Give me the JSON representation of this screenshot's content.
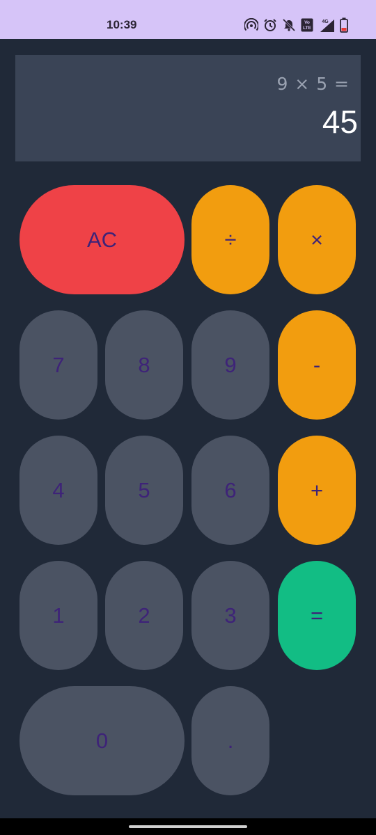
{
  "status_bar": {
    "time": "10:39",
    "icons": [
      "hotspot-icon",
      "alarm-icon",
      "mute-icon",
      "volte-icon",
      "signal-4g-icon",
      "battery-low-icon"
    ],
    "volte_text": "Vo LTE",
    "network_label": "4G"
  },
  "display": {
    "expression": "9 × 5 =",
    "result": "45"
  },
  "keypad": {
    "ac": "AC",
    "divide": "÷",
    "multiply": "×",
    "minus": "-",
    "plus": "+",
    "equals": "=",
    "seven": "7",
    "eight": "8",
    "nine": "9",
    "four": "4",
    "five": "5",
    "six": "6",
    "one": "1",
    "two": "2",
    "three": "3",
    "zero": "0",
    "dot": "."
  },
  "colors": {
    "background": "#202938",
    "display_bg": "#3a4456",
    "number_key": "#4b5363",
    "operator_key": "#f29d0f",
    "clear_key": "#ef4247",
    "equals_key": "#12bd84",
    "key_text": "#3e2378",
    "status_bar": "#d6c4f8"
  }
}
